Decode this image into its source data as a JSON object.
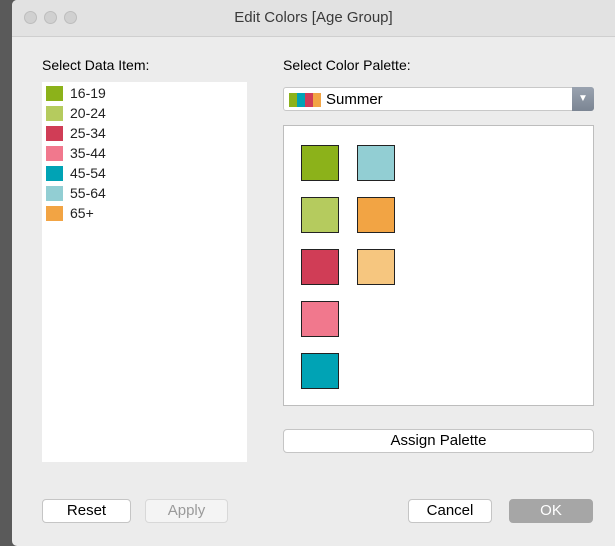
{
  "window": {
    "title": "Edit Colors [Age Group]"
  },
  "data_items": {
    "label": "Select Data Item:",
    "items": [
      {
        "label": "16-19",
        "color": "#8cb21a"
      },
      {
        "label": "20-24",
        "color": "#b5cb5e"
      },
      {
        "label": "25-34",
        "color": "#d03d56"
      },
      {
        "label": "35-44",
        "color": "#f1788d"
      },
      {
        "label": "45-54",
        "color": "#00a3b5"
      },
      {
        "label": "55-64",
        "color": "#92ced3"
      },
      {
        "label": "65+",
        "color": "#f2a444"
      }
    ]
  },
  "palette": {
    "label": "Select Color Palette:",
    "selected": "Summer",
    "icon_colors": [
      "#8cb21a",
      "#00a3b5",
      "#d03d56",
      "#f2a444"
    ],
    "swatches": [
      "#8cb21a",
      "#b5cb5e",
      "#d03d56",
      "#f1788d",
      "#00a3b5",
      "#92ced3",
      "#f2a444",
      "#f6c67f"
    ]
  },
  "buttons": {
    "assign": "Assign Palette",
    "reset": "Reset",
    "apply": "Apply",
    "cancel": "Cancel",
    "ok": "OK"
  }
}
